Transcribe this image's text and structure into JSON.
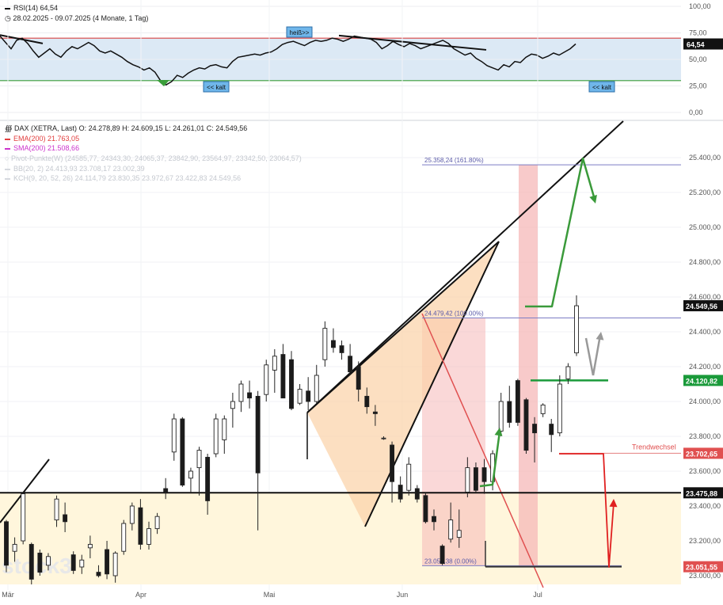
{
  "rsi_header": {
    "title": "RSI(14)",
    "value": "64,54",
    "range_text": "28.02.2025 - 09.07.2025",
    "period_text": "(4 Monate, 1 Tag)"
  },
  "main_header": {
    "symbol": "DAX (XETRA, Last)",
    "ohlc": "O: 24.278,89  H: 24.609,15  L: 24.261,01  C: 24.549,56",
    "indicators": [
      {
        "label": "EMA(200)",
        "value": "21.763,05",
        "color": "#e23d3d"
      },
      {
        "label": "SMA(200)",
        "value": "21.508,66",
        "color": "#cc33cc"
      },
      {
        "label": "Pivot-Punkte(W)",
        "value": "(24585,77, 24343,30, 24065,37, 23842,90, 23564,97, 23342,50, 23064,57)",
        "color": "#c4c8cf"
      },
      {
        "label": "BB(20, 2)",
        "value": "24.413,93  23.708,17  23.002,39",
        "color": "#c4c8cf"
      },
      {
        "label": "KCH(9, 20, 52, 26)",
        "value": "24.114,79  23.830,35  23.972,67  23.422,83  24.549,56",
        "color": "#c4c8cf"
      }
    ]
  },
  "chart_data": [
    {
      "type": "line",
      "name": "RSI(14)",
      "ylim": [
        0,
        100
      ],
      "y_ticks": [
        "100,00",
        "75,00",
        "50,00",
        "25,00",
        "0,00"
      ],
      "y_tick_values": [
        100,
        75,
        50,
        25,
        0
      ],
      "overbought": 70,
      "oversold": 30,
      "current_label": "64,54",
      "annotations": [
        "heiß>>",
        "<< kalt",
        "<< kalt"
      ],
      "values": [
        72,
        66,
        60,
        68,
        70,
        65,
        58,
        52,
        56,
        60,
        55,
        52,
        58,
        62,
        60,
        63,
        66,
        63,
        58,
        56,
        58,
        55,
        52,
        48,
        45,
        43,
        40,
        42,
        38,
        30,
        26,
        29,
        35,
        33,
        37,
        40,
        42,
        41,
        44,
        45,
        43,
        42,
        48,
        52,
        53,
        54,
        55,
        54,
        56,
        57,
        60,
        64,
        66,
        67,
        65,
        63,
        66,
        68,
        67,
        68,
        70,
        69,
        67,
        69,
        72,
        71,
        70,
        69,
        66,
        60,
        63,
        67,
        64,
        62,
        65,
        63,
        60,
        62,
        64,
        66,
        68,
        65,
        60,
        57,
        54,
        56,
        51,
        48,
        44,
        42,
        40,
        45,
        43,
        48,
        47,
        52,
        55,
        54,
        51,
        53,
        56,
        54,
        57,
        60,
        64.54
      ]
    },
    {
      "type": "candlestick",
      "name": "DAX (XETRA, Last)",
      "ylim": [
        22950,
        25820
      ],
      "y_ticks": [
        "25.400,00",
        "25.200,00",
        "25.000,00",
        "24.800,00",
        "24.600,00",
        "24.400,00",
        "24.200,00",
        "24.000,00",
        "23.800,00",
        "23.600,00",
        "23.400,00",
        "23.200,00",
        "23.000,00"
      ],
      "y_tick_values": [
        25400,
        25200,
        25000,
        24800,
        24600,
        24400,
        24200,
        24000,
        23800,
        23600,
        23400,
        23200,
        23000
      ],
      "x_ticks": [
        "Mär",
        "Apr",
        "Mai",
        "Jun",
        "Jul"
      ],
      "last_close": "24.549,56",
      "price_labels": [
        {
          "text": "24.549,56",
          "value": 24549.56,
          "color": "#111111"
        },
        {
          "text": "24.120,82",
          "value": 24120.82,
          "color": "#1a9a3a"
        },
        {
          "text": "23.702,65",
          "value": 23702.65,
          "color": "#e05050"
        },
        {
          "text": "23.475,88",
          "value": 23475.88,
          "color": "#111111"
        },
        {
          "text": "23.051,55",
          "value": 23051.55,
          "color": "#e05050"
        }
      ],
      "fib_levels": [
        {
          "text": "25.358,24 (161.80%)",
          "value": 25358.24
        },
        {
          "text": "24.479,42 (100.00%)",
          "value": 24479.42
        },
        {
          "text": "23.057,38 (0.00%)",
          "value": 23057.38
        }
      ],
      "annotations": [
        "Trendwechsel",
        "stock3"
      ],
      "candles": [
        {
          "o": 23310,
          "h": 23320,
          "l": 23020,
          "c": 23060
        },
        {
          "o": 23140,
          "h": 23220,
          "l": 23080,
          "c": 23180
        },
        {
          "o": 23200,
          "h": 23480,
          "l": 23180,
          "c": 23470
        },
        {
          "o": 23180,
          "h": 23190,
          "l": 22950,
          "c": 22980
        },
        {
          "o": 23130,
          "h": 23150,
          "l": 23000,
          "c": 23020
        },
        {
          "o": 23060,
          "h": 23130,
          "l": 23030,
          "c": 23110
        },
        {
          "o": 23320,
          "h": 23460,
          "l": 23280,
          "c": 23440
        },
        {
          "o": 23350,
          "h": 23420,
          "l": 23250,
          "c": 23310
        },
        {
          "o": 23120,
          "h": 23140,
          "l": 23010,
          "c": 23030
        },
        {
          "o": 23050,
          "h": 23120,
          "l": 23010,
          "c": 23090
        },
        {
          "o": 23160,
          "h": 23230,
          "l": 23100,
          "c": 23180
        },
        {
          "o": 23020,
          "h": 23060,
          "l": 22990,
          "c": 23000
        },
        {
          "o": 23150,
          "h": 23200,
          "l": 22980,
          "c": 23010
        },
        {
          "o": 23000,
          "h": 23140,
          "l": 22960,
          "c": 23130
        },
        {
          "o": 23140,
          "h": 23320,
          "l": 23120,
          "c": 23300
        },
        {
          "o": 23300,
          "h": 23420,
          "l": 23260,
          "c": 23400
        },
        {
          "o": 23390,
          "h": 23440,
          "l": 23150,
          "c": 23180
        },
        {
          "o": 23180,
          "h": 23310,
          "l": 23150,
          "c": 23270
        },
        {
          "o": 23270,
          "h": 23360,
          "l": 23240,
          "c": 23340
        },
        {
          "o": 23500,
          "h": 23560,
          "l": 23440,
          "c": 23480
        },
        {
          "o": 23710,
          "h": 23930,
          "l": 23660,
          "c": 23900
        },
        {
          "o": 23900,
          "h": 23910,
          "l": 23510,
          "c": 23520
        },
        {
          "o": 23560,
          "h": 23620,
          "l": 23480,
          "c": 23600
        },
        {
          "o": 23620,
          "h": 23740,
          "l": 23460,
          "c": 23720
        },
        {
          "o": 23680,
          "h": 23700,
          "l": 23350,
          "c": 23430
        },
        {
          "o": 23700,
          "h": 23930,
          "l": 23680,
          "c": 23900
        },
        {
          "o": 23780,
          "h": 23920,
          "l": 23700,
          "c": 23900
        },
        {
          "o": 23960,
          "h": 24050,
          "l": 23850,
          "c": 24000
        },
        {
          "o": 24000,
          "h": 24120,
          "l": 23940,
          "c": 24100
        },
        {
          "o": 24050,
          "h": 24120,
          "l": 23960,
          "c": 24020
        },
        {
          "o": 24030,
          "h": 24060,
          "l": 23260,
          "c": 23590
        },
        {
          "o": 24040,
          "h": 24240,
          "l": 24000,
          "c": 24210
        },
        {
          "o": 24180,
          "h": 24300,
          "l": 24050,
          "c": 24260
        },
        {
          "o": 24270,
          "h": 24330,
          "l": 24020,
          "c": 24020
        },
        {
          "o": 24240,
          "h": 24290,
          "l": 23950,
          "c": 23960
        },
        {
          "o": 23990,
          "h": 24100,
          "l": 23980,
          "c": 24070
        },
        {
          "o": 24060,
          "h": 24140,
          "l": 23950,
          "c": 24000
        },
        {
          "o": 24000,
          "h": 24210,
          "l": 23990,
          "c": 24150
        },
        {
          "o": 24240,
          "h": 24460,
          "l": 24200,
          "c": 24420
        },
        {
          "o": 24350,
          "h": 24420,
          "l": 24280,
          "c": 24310
        },
        {
          "o": 24320,
          "h": 24350,
          "l": 24240,
          "c": 24280
        },
        {
          "o": 24260,
          "h": 24330,
          "l": 24150,
          "c": 24170
        },
        {
          "o": 24200,
          "h": 24230,
          "l": 24000,
          "c": 24070
        },
        {
          "o": 24030,
          "h": 24080,
          "l": 23930,
          "c": 23970
        },
        {
          "o": 23940,
          "h": 23980,
          "l": 23860,
          "c": 23930
        },
        {
          "o": 23790,
          "h": 23800,
          "l": 23780,
          "c": 23790
        },
        {
          "o": 23750,
          "h": 23770,
          "l": 23420,
          "c": 23540
        },
        {
          "o": 23520,
          "h": 23570,
          "l": 23420,
          "c": 23440
        },
        {
          "o": 23490,
          "h": 23680,
          "l": 23460,
          "c": 23640
        },
        {
          "o": 23500,
          "h": 23520,
          "l": 23420,
          "c": 23440
        },
        {
          "o": 23460,
          "h": 23480,
          "l": 23300,
          "c": 23310
        },
        {
          "o": 23340,
          "h": 23380,
          "l": 23260,
          "c": 23310
        },
        {
          "o": 23170,
          "h": 23180,
          "l": 23060,
          "c": 23070
        },
        {
          "o": 23210,
          "h": 23420,
          "l": 23190,
          "c": 23320
        },
        {
          "o": 23220,
          "h": 23380,
          "l": 23160,
          "c": 23260
        },
        {
          "o": 23480,
          "h": 23680,
          "l": 23450,
          "c": 23620
        },
        {
          "o": 23620,
          "h": 23650,
          "l": 23480,
          "c": 23490
        },
        {
          "o": 23620,
          "h": 23670,
          "l": 23470,
          "c": 23540
        },
        {
          "o": 23540,
          "h": 23720,
          "l": 23490,
          "c": 23700
        },
        {
          "o": 23830,
          "h": 24050,
          "l": 23800,
          "c": 24000
        },
        {
          "o": 24000,
          "h": 24090,
          "l": 23850,
          "c": 23880
        },
        {
          "o": 24120,
          "h": 24130,
          "l": 23860,
          "c": 23880
        },
        {
          "o": 24010,
          "h": 24020,
          "l": 23700,
          "c": 23720
        },
        {
          "o": 23870,
          "h": 23910,
          "l": 23650,
          "c": 23820
        },
        {
          "o": 23930,
          "h": 23990,
          "l": 23910,
          "c": 23980
        },
        {
          "o": 23870,
          "h": 23900,
          "l": 23710,
          "c": 23810
        },
        {
          "o": 23820,
          "h": 24150,
          "l": 23800,
          "c": 24100
        },
        {
          "o": 24130,
          "h": 24220,
          "l": 24100,
          "c": 24200
        },
        {
          "o": 24278.89,
          "h": 24609.15,
          "l": 24261.01,
          "c": 24549.56
        }
      ]
    }
  ],
  "colors": {
    "rsi_band": "#dce9f5",
    "overbought_line": "#d94545",
    "oversold_line": "#3a9e3a",
    "bull_arrow": "#3a9a3a",
    "bear_arrow": "#e02020",
    "wedge_fill": "#fbd2a6",
    "zone_fill": "#f6b8b8",
    "support_zone": "#fff6dc"
  }
}
